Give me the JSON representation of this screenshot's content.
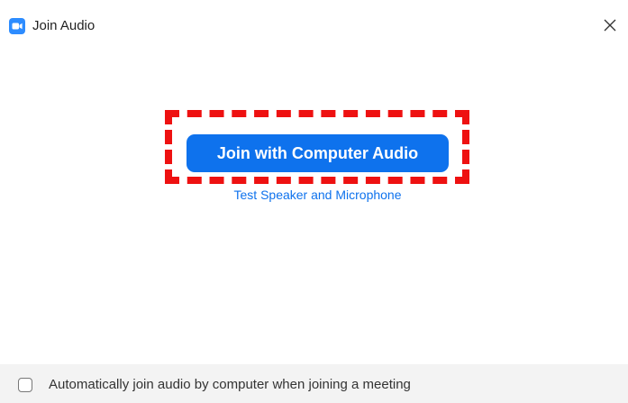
{
  "window": {
    "title": "Join Audio",
    "icon": "zoom-camera-icon",
    "close_icon": "close-icon"
  },
  "main": {
    "join_button_label": "Join with Computer Audio",
    "test_link_label": "Test Speaker and Microphone"
  },
  "footer": {
    "auto_join_label": "Automatically join audio by computer when joining a meeting",
    "auto_join_checked": false
  },
  "colors": {
    "accent": "#0e72ed",
    "highlight": "#ee1111",
    "footer_bg": "#f3f3f3"
  }
}
